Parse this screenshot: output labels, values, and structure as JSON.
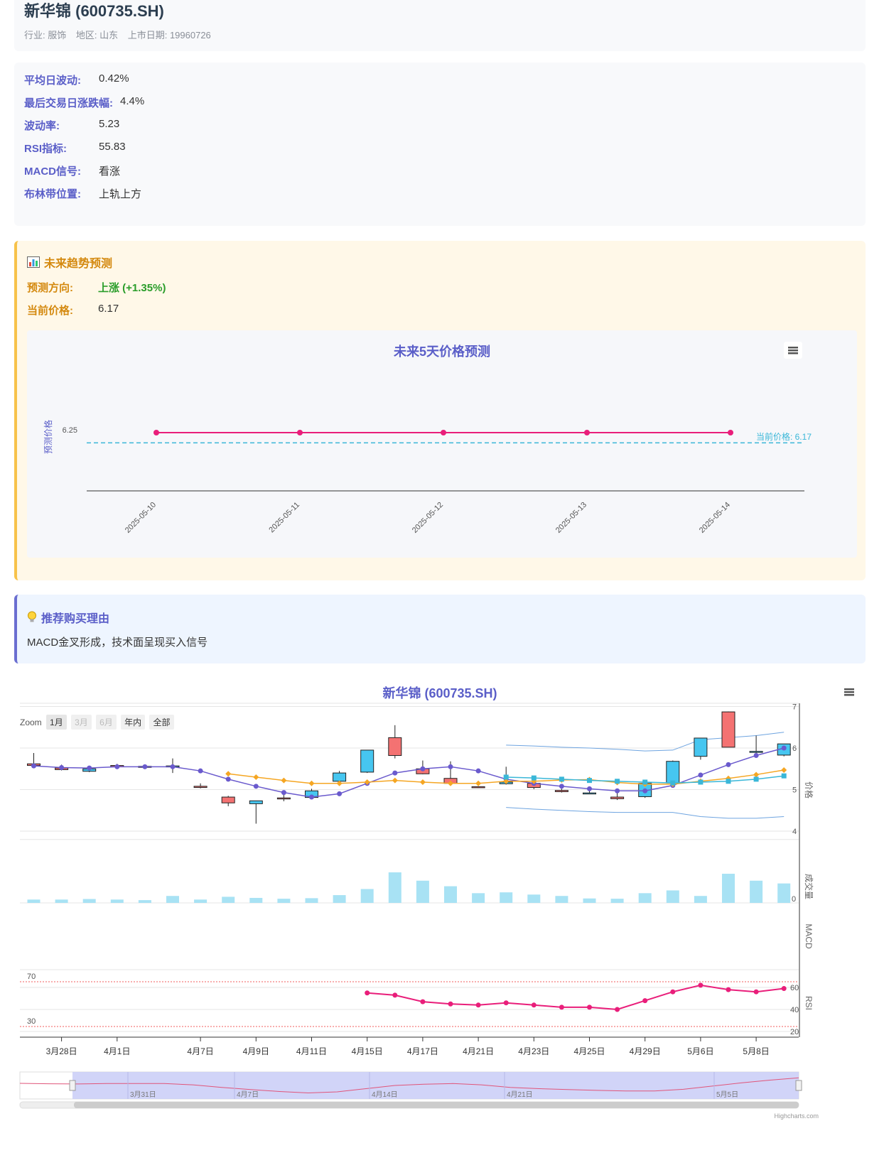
{
  "header": {
    "title": "新华锦 (600735.SH)",
    "industry": "行业: 服饰",
    "region": "地区: 山东",
    "listing_date": "上市日期: 19960726"
  },
  "metrics": [
    {
      "label": "平均日波动:",
      "value": "0.42%"
    },
    {
      "label": "最后交易日涨跌幅:",
      "value": "4.4%"
    },
    {
      "label": "波动率:",
      "value": "5.23"
    },
    {
      "label": "RSI指标:",
      "value": "55.83"
    },
    {
      "label": "MACD信号:",
      "value": "看涨"
    },
    {
      "label": "布林带位置:",
      "value": "上轨上方"
    }
  ],
  "forecast": {
    "heading": "未来趋势预测",
    "direction_label": "预测方向:",
    "direction_value": "上涨 (+1.35%)",
    "price_label": "当前价格:",
    "price_value": "6.17",
    "colors": {
      "accent": "#f7c24a",
      "label": "#d4890f",
      "up": "#2a9d2a"
    }
  },
  "reason": {
    "heading": "推荐购买理由",
    "text": "MACD金叉形成，技术面呈现买入信号"
  },
  "main_chart": {
    "title": "新华锦 (600735.SH)",
    "zoom_label": "Zoom",
    "zoom_buttons": [
      "1月",
      "3月",
      "6月",
      "年内",
      "全部"
    ]
  },
  "chart_data": [
    {
      "type": "line",
      "title": "未来5天价格预测",
      "ylabel": "预测价格",
      "categories": [
        "2025-05-10",
        "2025-05-11",
        "2025-05-12",
        "2025-05-13",
        "2025-05-14"
      ],
      "values": [
        6.25,
        6.25,
        6.25,
        6.25,
        6.25
      ],
      "ytick": "6.25",
      "reference_line": {
        "label": "当前价格: 6.17",
        "value": 6.17
      },
      "colors": {
        "line": "#e91e7a",
        "reference": "#3ab7d8"
      }
    },
    {
      "type": "candlestick",
      "title": "新华锦 (600735.SH)",
      "dates": [
        "3/27",
        "3/28",
        "3/31",
        "4/1",
        "4/2",
        "4/3",
        "4/7",
        "4/8",
        "4/9",
        "4/10",
        "4/11",
        "4/14",
        "4/15",
        "4/16",
        "4/17",
        "4/18",
        "4/21",
        "4/22",
        "4/23",
        "4/24",
        "4/25",
        "4/28",
        "4/29",
        "4/30",
        "5/6",
        "5/7",
        "5/8",
        "5/9"
      ],
      "x_tick_labels": [
        "3月28日",
        "4月1日",
        "4月7日",
        "4月9日",
        "4月11日",
        "4月15日",
        "4月17日",
        "4月21日",
        "4月23日",
        "4月25日",
        "4月29日",
        "5月6日",
        "5月8日"
      ],
      "ohlc": [
        [
          5.62,
          5.88,
          5.6,
          5.58
        ],
        [
          5.52,
          5.6,
          5.46,
          5.48
        ],
        [
          5.44,
          5.55,
          5.42,
          5.5
        ],
        [
          5.58,
          5.62,
          5.54,
          5.56
        ],
        [
          5.56,
          5.58,
          5.54,
          5.55
        ],
        [
          5.55,
          5.75,
          5.4,
          5.57
        ],
        [
          5.08,
          5.15,
          5.03,
          5.05
        ],
        [
          4.82,
          4.85,
          4.6,
          4.68
        ],
        [
          4.66,
          4.69,
          4.18,
          4.73
        ],
        [
          4.8,
          4.9,
          4.72,
          4.79
        ],
        [
          4.81,
          5.02,
          4.78,
          4.97
        ],
        [
          5.2,
          5.45,
          5.18,
          5.4
        ],
        [
          5.42,
          5.95,
          5.4,
          5.95
        ],
        [
          6.25,
          6.55,
          5.75,
          5.82
        ],
        [
          5.5,
          5.7,
          5.37,
          5.38
        ],
        [
          5.27,
          5.68,
          5.13,
          5.15
        ],
        [
          5.07,
          5.08,
          5.04,
          5.05
        ],
        [
          5.14,
          5.55,
          5.12,
          5.18
        ],
        [
          5.15,
          5.22,
          5.01,
          5.05
        ],
        [
          4.98,
          5.02,
          4.93,
          4.95
        ],
        [
          4.92,
          5.02,
          4.9,
          4.92
        ],
        [
          4.82,
          4.95,
          4.75,
          4.78
        ],
        [
          4.83,
          5.2,
          4.8,
          5.15
        ],
        [
          5.16,
          5.7,
          5.1,
          5.68
        ],
        [
          5.8,
          6.24,
          5.72,
          6.24
        ],
        [
          6.87,
          6.88,
          6.02,
          6.02
        ],
        [
          5.9,
          6.3,
          5.88,
          5.92
        ],
        [
          5.83,
          6.08,
          5.8,
          6.1
        ]
      ],
      "y_ticks": [
        4,
        5,
        6,
        7
      ],
      "ylim": [
        3.9,
        7.6
      ],
      "ylabel": "价格",
      "ma_a": [
        5.57,
        5.53,
        5.52,
        5.55,
        5.55,
        5.55,
        5.45,
        5.25,
        5.08,
        4.93,
        4.82,
        4.9,
        5.15,
        5.4,
        5.5,
        5.55,
        5.45,
        5.25,
        5.15,
        5.08,
        5.02,
        4.97,
        4.97,
        5.1,
        5.35,
        5.6,
        5.82,
        6.0
      ],
      "ma_b": [
        null,
        null,
        null,
        null,
        null,
        null,
        null,
        5.38,
        5.3,
        5.22,
        5.15,
        5.15,
        5.18,
        5.22,
        5.18,
        5.15,
        5.15,
        5.2,
        5.2,
        5.23,
        5.24,
        5.17,
        5.13,
        5.13,
        5.2,
        5.27,
        5.36,
        5.47
      ],
      "ma_c": [
        null,
        null,
        null,
        null,
        null,
        null,
        null,
        null,
        null,
        null,
        null,
        null,
        null,
        null,
        null,
        null,
        null,
        5.3,
        5.28,
        5.25,
        5.22,
        5.2,
        5.18,
        5.16,
        5.18,
        5.2,
        5.25,
        5.33
      ],
      "boll_upper": [
        null,
        null,
        null,
        null,
        null,
        null,
        null,
        null,
        null,
        null,
        null,
        null,
        null,
        null,
        null,
        null,
        null,
        6.07,
        6.05,
        6.02,
        6.0,
        5.97,
        5.93,
        5.95,
        6.2,
        6.25,
        6.3,
        6.38
      ],
      "boll_lower": [
        null,
        null,
        null,
        null,
        null,
        null,
        null,
        null,
        null,
        null,
        null,
        null,
        null,
        null,
        null,
        null,
        null,
        4.57,
        4.53,
        4.5,
        4.47,
        4.45,
        4.45,
        4.45,
        4.35,
        4.31,
        4.31,
        4.35
      ],
      "volume": [
        12,
        12,
        14,
        12,
        10,
        25,
        12,
        22,
        18,
        15,
        17,
        28,
        50,
        110,
        80,
        60,
        35,
        38,
        30,
        25,
        16,
        15,
        35,
        45,
        25,
        105,
        80,
        70
      ],
      "volume_ylabel": "成交量",
      "volume_tick": "0",
      "macd_ylabel": "MACD",
      "rsi": [
        null,
        null,
        null,
        null,
        null,
        null,
        null,
        null,
        null,
        null,
        null,
        null,
        55,
        53,
        47,
        45,
        44,
        46,
        44,
        42,
        42,
        40,
        48,
        56,
        62,
        58,
        56,
        59
      ],
      "rsi_ylabel": "RSI",
      "rsi_ticks": [
        20,
        40,
        60
      ],
      "rsi_lines": [
        "70",
        "30"
      ],
      "navigator_labels": [
        "3月31日",
        "4月7日",
        "4月14日",
        "4月21日",
        "5月5日"
      ],
      "credit": "Highcharts.com",
      "colors": {
        "up": "#f47272",
        "down": "#46c6f0",
        "ma_a": "#6a5acd",
        "ma_b": "#f5a623",
        "ma_c": "#3ab7d8",
        "boll": "#6ea4e0",
        "volume": "#a8e2f4",
        "rsi": "#e91e7a"
      }
    }
  ]
}
